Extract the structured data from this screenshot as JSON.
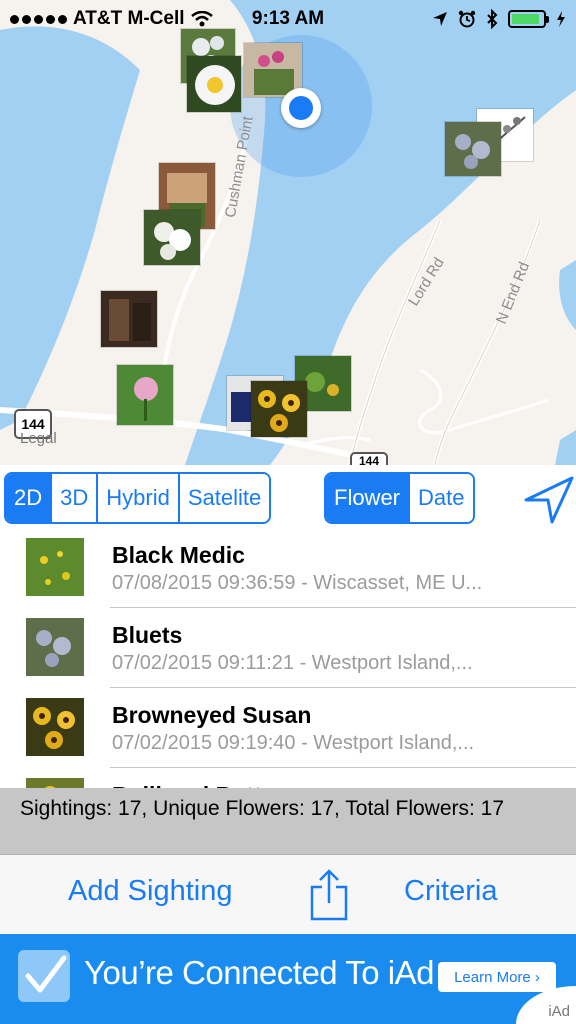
{
  "status_bar": {
    "carrier": "AT&T M-Cell",
    "time": "9:13 AM",
    "battery_level": 0.9,
    "icons": [
      "signal-dots-icon",
      "wifi-icon",
      "location-arrow-icon",
      "alarm-icon",
      "bluetooth-icon",
      "battery-icon",
      "charging-bolt-icon"
    ]
  },
  "map": {
    "labels": {
      "cushman_point": "Cushman Point",
      "lord_rd": "Lord Rd",
      "n_end_rd": "N End Rd"
    },
    "route_shield": "144",
    "route_shield_bottom": "144",
    "legal": "Legal",
    "colors": {
      "water": "#a2d0f2",
      "land": "#f6f3ee",
      "road": "#ffffff"
    }
  },
  "map_type_control": {
    "options": [
      "2D",
      "3D",
      "Hybrid",
      "Satelite"
    ],
    "selected": "2D"
  },
  "sort_control": {
    "options": [
      "Flower",
      "Date"
    ],
    "selected": "Flower"
  },
  "sightings_list": [
    {
      "name": "Black Medic",
      "detail": "07/08/2015 09:36:59 - Wiscasset, ME  U..."
    },
    {
      "name": "Bluets",
      "detail": "07/02/2015 09:11:21 - Westport Island,..."
    },
    {
      "name": "Browneyed Susan",
      "detail": "07/02/2015 09:19:40 - Westport Island,..."
    },
    {
      "name": "Bullhead Butt...",
      "detail": ""
    }
  ],
  "summary": "Sightings: 17, Unique Flowers: 17, Total Flowers: 17",
  "toolbar": {
    "add_sighting": "Add Sighting",
    "criteria": "Criteria"
  },
  "ad": {
    "text": "You’re Connected To iAd",
    "learn_more": "Learn More ›",
    "logo": "iAd"
  },
  "colors": {
    "accent": "#1a7cf5",
    "summary_bar": "#c6c6c6",
    "ad_background": "#1a8cf0"
  }
}
